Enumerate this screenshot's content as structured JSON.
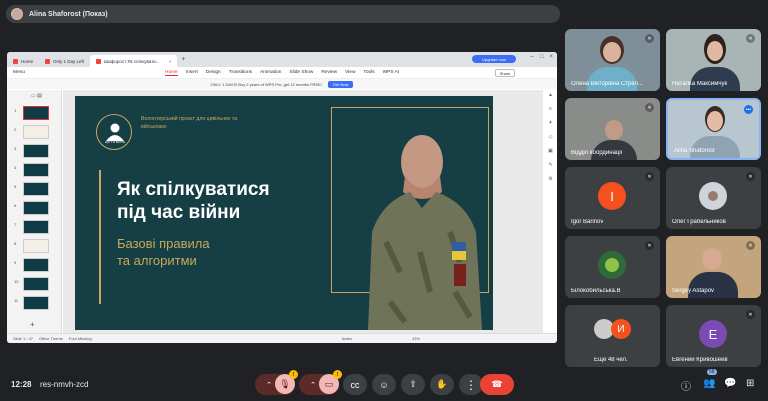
{
  "presenter": {
    "name": "Alina Shaforost (Показ)"
  },
  "browser": {
    "tabs": [
      {
        "label": "Home"
      },
      {
        "label": "Only 1 Day Left"
      },
      {
        "label": "Шафорост Як спілкувати..."
      }
    ],
    "upgrade_label": "Upgrade now"
  },
  "app": {
    "menu_label": "Menu",
    "ribbon": [
      "Home",
      "Insert",
      "Design",
      "Transitions",
      "Animation",
      "Slide Show",
      "Review",
      "View",
      "Tools"
    ],
    "wps_ai": "WPS AI",
    "share": "Share",
    "promo_text": "ONLY 1 DAYS! Buy 2 years of WPS Pro, get 12 months FREE!",
    "promo_button": "Get Now",
    "status_slide": "Slide 1 / 47",
    "status_theme": "Office Theme",
    "status_font": "Font Missing",
    "status_notes": "Notes",
    "zoom": "43%"
  },
  "slide": {
    "logo_text": "ЩО ТИ БРАТЕ",
    "subtitle": "Волонтерський проєкт для цивільних та військових",
    "title_line1": "Як спілкуватися",
    "title_line2": "під час війни",
    "subtitle_line1": "Базові правила",
    "subtitle_line2": "та алгоритми"
  },
  "thumbnails": [
    1,
    2,
    3,
    4,
    5,
    6,
    7,
    8,
    9,
    10,
    11
  ],
  "participants": [
    {
      "name": "Олена Вікторівна Стрел..."
    },
    {
      "name": "Наталка Максимчук"
    },
    {
      "name": "Відділ координації"
    },
    {
      "name": "Alina Shaforost"
    },
    {
      "name": "Igor Barinov",
      "initial": "I",
      "color": "#f4511e"
    },
    {
      "name": "Олег Грабельников"
    },
    {
      "name": "Білокобильська.В"
    },
    {
      "name": "Sergey Astapov"
    },
    {
      "name": "Ещё 48 чел."
    },
    {
      "name": "Евгений Кривошеев",
      "initial": "E",
      "color": "#7b4ab3"
    }
  ],
  "meeting": {
    "time": "12:28",
    "code": "res-nmvh-zcd",
    "people_count": "58",
    "mic_badge": "!",
    "cam_badge": "!"
  }
}
